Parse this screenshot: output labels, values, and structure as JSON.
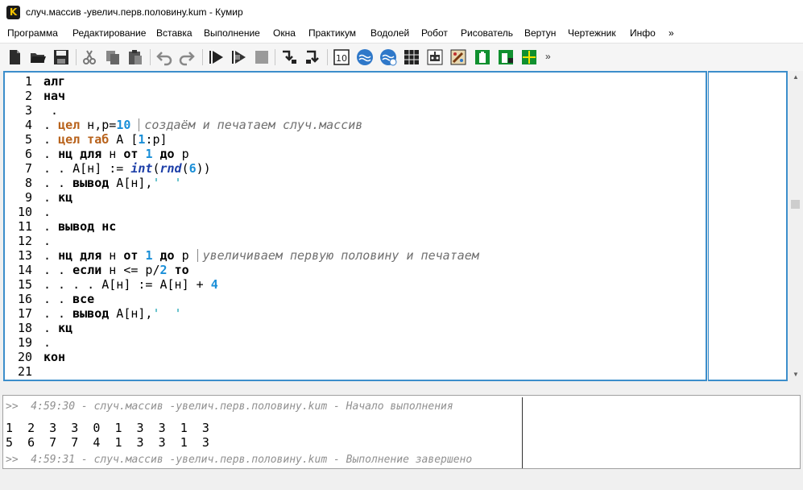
{
  "window": {
    "title": "случ.массив -увелич.перв.половину.kum - Кумир",
    "app_icon_letter": "K"
  },
  "menu": [
    "Программа",
    "Редактирование",
    "Вставка",
    "Выполнение",
    "Окна",
    "Практикум",
    "Водолей",
    "Робот",
    "Рисователь",
    "Вертун",
    "Чертежник",
    "Инфо",
    "»"
  ],
  "toolbar": {
    "more": "»",
    "buttons": [
      "new-file-icon",
      "open-folder-icon",
      "save-icon",
      "cut-icon",
      "copy-icon",
      "paste-icon",
      "undo-icon",
      "redo-icon",
      "run-icon",
      "run-step-icon",
      "stop-icon",
      "step-into-icon",
      "step-out-icon",
      "numbers-icon",
      "water-icon",
      "water-check-icon",
      "grid-icon",
      "robot-icon",
      "painter-icon",
      "turtle-icon",
      "turtle-flag-icon",
      "draftsman-icon"
    ]
  },
  "editor": {
    "lines": [
      {
        "n": "1",
        "code": "алг"
      },
      {
        "n": "2",
        "code": "нач"
      },
      {
        "n": "3",
        "code": " ."
      },
      {
        "n": "4",
        "code": ". цел н,р=10",
        "comment": "создаём и печатаем случ.массив"
      },
      {
        "n": "5",
        "code": ". цел таб А [1:р]"
      },
      {
        "n": "6",
        "code": ". нц для н от 1 до р"
      },
      {
        "n": "7",
        "code": ". . А[н] := int(rnd(6))"
      },
      {
        "n": "8",
        "code": ". . вывод А[н],'  '"
      },
      {
        "n": "9",
        "code": ". кц"
      },
      {
        "n": "10",
        "code": "."
      },
      {
        "n": "11",
        "code": ". вывод нс"
      },
      {
        "n": "12",
        "code": "."
      },
      {
        "n": "13",
        "code": ". нц для н от 1 до р",
        "comment": "увеличиваем первую половину и печатаем"
      },
      {
        "n": "14",
        "code": ". . если н <= р/2 то"
      },
      {
        "n": "15",
        "code": ". . . . А[н] := А[н] + 4"
      },
      {
        "n": "16",
        "code": ". . все"
      },
      {
        "n": "17",
        "code": ". . вывод А[н],'  '"
      },
      {
        "n": "18",
        "code": ". кц"
      },
      {
        "n": "19",
        "code": "."
      },
      {
        "n": "20",
        "code": "кон"
      },
      {
        "n": "21",
        "code": ""
      }
    ]
  },
  "console": {
    "start_msg": ">>  4:59:30 - случ.массив -увелич.перв.половину.kum - Начало выполнения",
    "row1": "1  2  3  3  0  1  3  3  1  3",
    "row2": "5  6  7  7  4  1  3  3  1  3",
    "end_msg": ">>  4:59:31 - случ.массив -увелич.перв.половину.kum - Выполнение завершено"
  },
  "colors": {
    "keyword_orange": "#b8621b",
    "number_blue": "#1a8fd8",
    "function_blue": "#1d3fa8",
    "comment_gray": "#707070",
    "string_teal": "#1aa3b3",
    "pane_border": "#3c8ecb"
  }
}
